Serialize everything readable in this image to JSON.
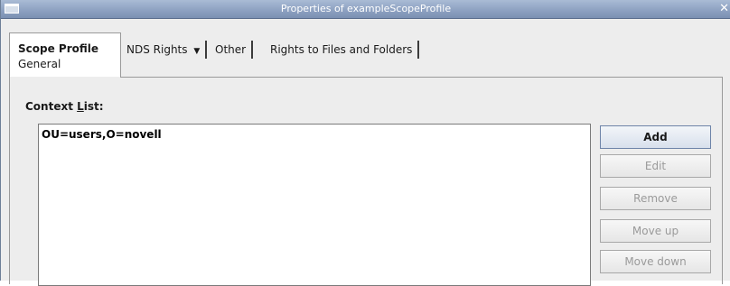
{
  "window": {
    "title": "Properties of exampleScopeProfile"
  },
  "tabs": {
    "active": {
      "label": "Scope Profile",
      "sublabel": "General"
    },
    "items": [
      {
        "label": "NDS Rights",
        "dropdown": true
      },
      {
        "label": "Other"
      },
      {
        "label": "Rights to Files and Folders"
      }
    ]
  },
  "context_list": {
    "label_pre": "Context ",
    "label_mnemonic": "L",
    "label_post": "ist:",
    "items": [
      "OU=users,O=novell"
    ]
  },
  "buttons": {
    "add": "Add",
    "edit": "Edit",
    "remove": "Remove",
    "move_up": "Move up",
    "move_down": "Move down"
  },
  "icons": {
    "window": "window-menu-icon",
    "close": "close-icon",
    "dropdown": "dropdown-arrow-icon"
  }
}
